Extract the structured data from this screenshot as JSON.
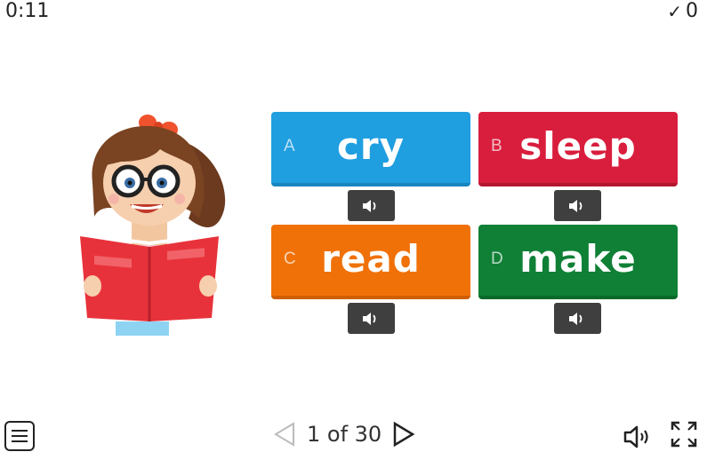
{
  "header": {
    "timer": "0:11",
    "score_icon": "check-icon",
    "score": "0"
  },
  "answers": [
    {
      "letter": "A",
      "word": "cry",
      "color": "#1f9ee0"
    },
    {
      "letter": "B",
      "word": "sleep",
      "color": "#d91e3d"
    },
    {
      "letter": "C",
      "word": "read",
      "color": "#f07108"
    },
    {
      "letter": "D",
      "word": "make",
      "color": "#0f8036"
    }
  ],
  "sound_icon": "speaker-icon",
  "footer": {
    "menu_icon": "menu-icon",
    "page_label": "1 of 30",
    "prev_icon": "triangle-left-icon",
    "next_icon": "triangle-right-icon",
    "volume_icon": "volume-icon",
    "fullscreen_icon": "fullscreen-icon"
  }
}
